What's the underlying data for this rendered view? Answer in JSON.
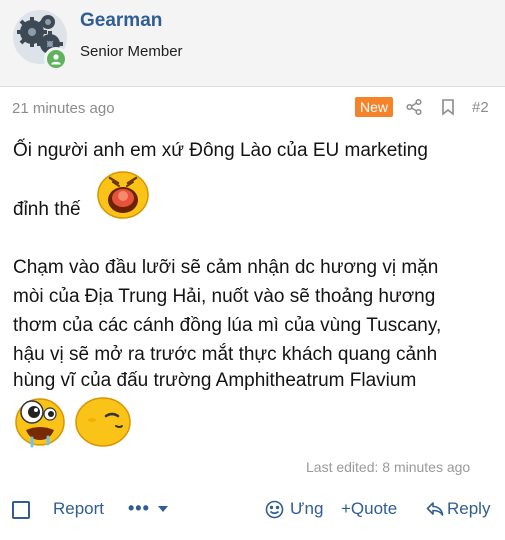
{
  "user": {
    "name": "Gearman",
    "title": "Senior Member",
    "avatar_icon": "gears-avatar",
    "online_status_icon": "online-user-icon"
  },
  "post": {
    "timestamp": "21 minutes ago",
    "badge": "New",
    "number": "#2",
    "lines": [
      "Ối người anh em xứ Đông Lào của EU marketing",
      "đỉnh thế",
      "Chạm vào đầu lưỡi sẽ cảm nhận dc hương vị mặn",
      "mòi của Địa Trung Hải, nuốt vào sẽ thoảng hương",
      "thơm của các cánh đồng lúa mì của vùng Tuscany,",
      "hậu vị sẽ mở ra trước mắt thực khách quang cảnh",
      "hùng vĩ của đấu trường Amphitheatrum Flavium"
    ],
    "emojis": [
      "shouting-smiley-icon",
      "drooling-smiley-icon",
      "smirking-smiley-icon"
    ],
    "last_edited": "Last edited: 8 minutes ago"
  },
  "actions": {
    "report": "Report",
    "more": "•••",
    "react": "Ưng",
    "quote": "+Quote",
    "reply": "Reply"
  },
  "colors": {
    "link": "#2f5d94",
    "badge": "#f4832a",
    "online": "#5fb35c",
    "emoji_yellow": "#f9c417"
  }
}
